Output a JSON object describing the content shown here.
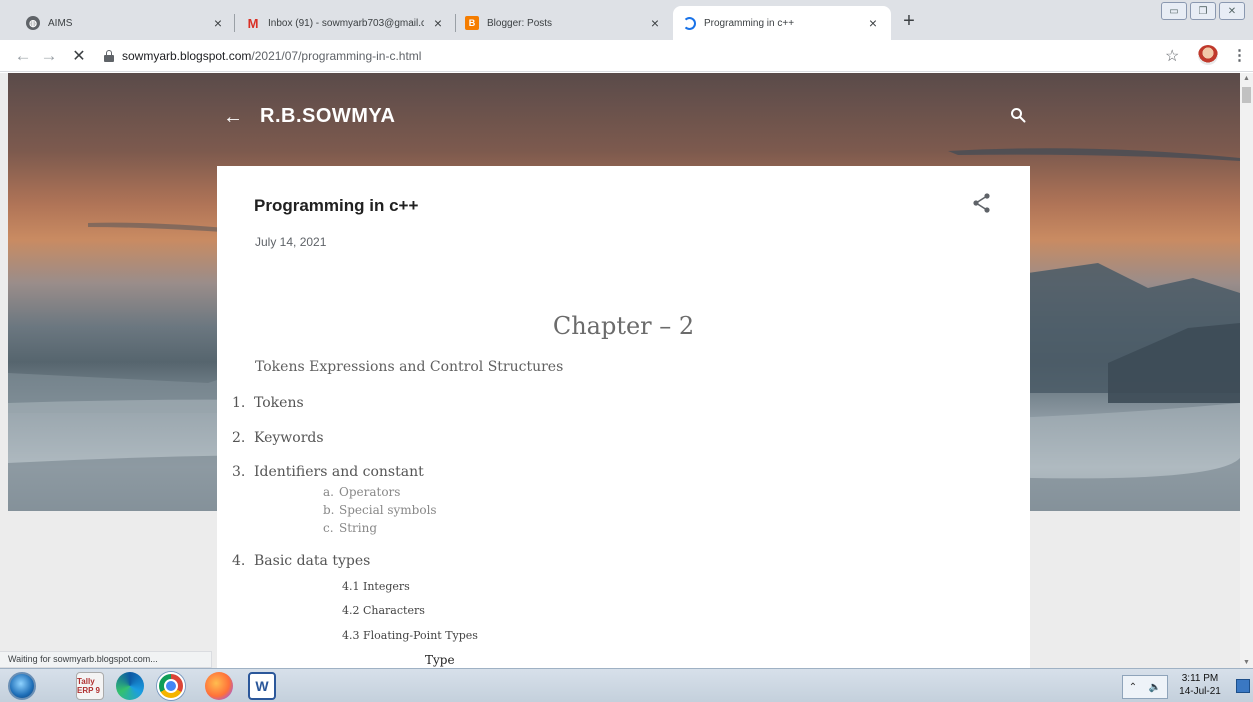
{
  "browser": {
    "tabs": [
      {
        "title": "AIMS",
        "favicon": "globe-icon"
      },
      {
        "title": "Inbox (91) - sowmyarb703@gmail.cc",
        "favicon": "gmail-icon"
      },
      {
        "title": "Blogger: Posts",
        "favicon": "blogger-icon"
      },
      {
        "title": "Programming in c++",
        "favicon": "loading-spinner-icon",
        "active": true
      }
    ],
    "new_tab_label": "+",
    "url_host": "sowmyarb.blogspot.com",
    "url_path": "/2021/07/programming-in-c.html",
    "status_text": "Waiting for sowmyarb.blogspot.com..."
  },
  "blog": {
    "name": "R.B.SOWMYA",
    "post_title": "Programming in c++",
    "post_date": "July 14, 2021"
  },
  "doc": {
    "chapter": "Chapter – 2",
    "subtitle": "Tokens Expressions and Control Structures",
    "items": [
      {
        "num": "1.",
        "label": "Tokens"
      },
      {
        "num": "2.",
        "label": "Keywords"
      },
      {
        "num": "3.",
        "label": "Identifiers and constant"
      },
      {
        "num": "4.",
        "label": "Basic data types"
      }
    ],
    "subitems": [
      {
        "num": "a.",
        "label": "Operators"
      },
      {
        "num": "b.",
        "label": "Special symbols"
      },
      {
        "num": "c.",
        "label": "String"
      }
    ],
    "datatypes": [
      "4.1 Integers",
      "4.2 Characters",
      "4.3 Floating-Point Types"
    ],
    "cut_text": "Type"
  },
  "taskbar": {
    "tally_label": "Tally ERP 9",
    "word_label": "W",
    "time": "3:11 PM",
    "date": "14-Jul-21"
  }
}
